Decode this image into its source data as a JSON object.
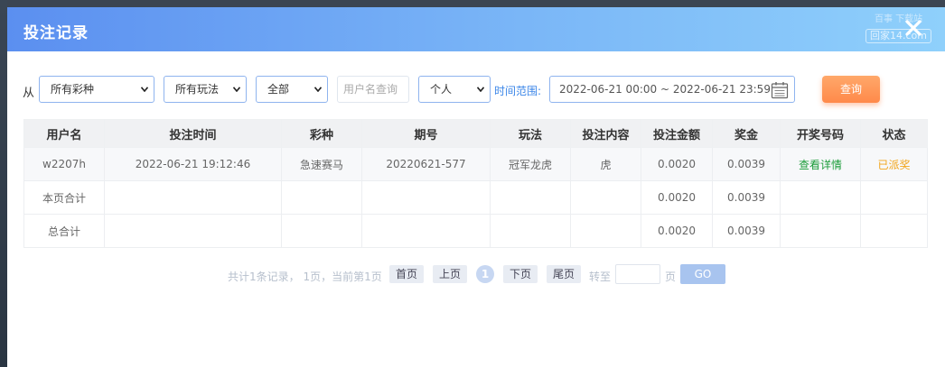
{
  "dialog": {
    "title": "投注记录",
    "watermark_top": "百事 下载站",
    "watermark_box": "回家14.com"
  },
  "filters": {
    "from_label": "从",
    "lottery_select": "所有彩种",
    "play_select": "所有玩法",
    "status_select": "全部",
    "user_placeholder": "用户名查询",
    "scope_select": "个人",
    "range_label": "时间范围:",
    "date_range": "2022-06-21 00:00 ~ 2022-06-21 23:59",
    "query_button": "查询"
  },
  "table": {
    "headers": [
      "用户名",
      "投注时间",
      "彩种",
      "期号",
      "玩法",
      "投注内容",
      "投注金额",
      "奖金",
      "开奖号码",
      "状态"
    ],
    "rows": [
      {
        "username": "w2207h",
        "time": "2022-06-21 19:12:46",
        "lottery": "急速赛马",
        "issue": "20220621-577",
        "play": "冠军龙虎",
        "content": "虎",
        "amount": "0.0020",
        "prize": "0.0039",
        "draw_link": "查看详情",
        "status": "已派奖"
      }
    ],
    "page_total": {
      "label": "本页合计",
      "amount": "0.0020",
      "prize": "0.0039"
    },
    "grand_total": {
      "label": "总合计",
      "amount": "0.0020",
      "prize": "0.0039"
    }
  },
  "pager": {
    "info": "共计1条记录， 1页，当前第1页",
    "first": "首页",
    "prev": "上页",
    "current": "1",
    "next": "下页",
    "last": "尾页",
    "goto_label": "转至",
    "page_label": "页",
    "go": "GO"
  },
  "colors": {
    "header_gradient_start": "#5b8ff0",
    "header_gradient_end": "#8fd0fb",
    "query_button": "#ff8a4a",
    "link_green": "#1c9c3a",
    "status_orange": "#f2a51b",
    "range_label_blue": "#3b86e8"
  },
  "icons": {
    "close": "close-icon",
    "calendar": "calendar-icon",
    "caret": "chevron-down-icon"
  }
}
